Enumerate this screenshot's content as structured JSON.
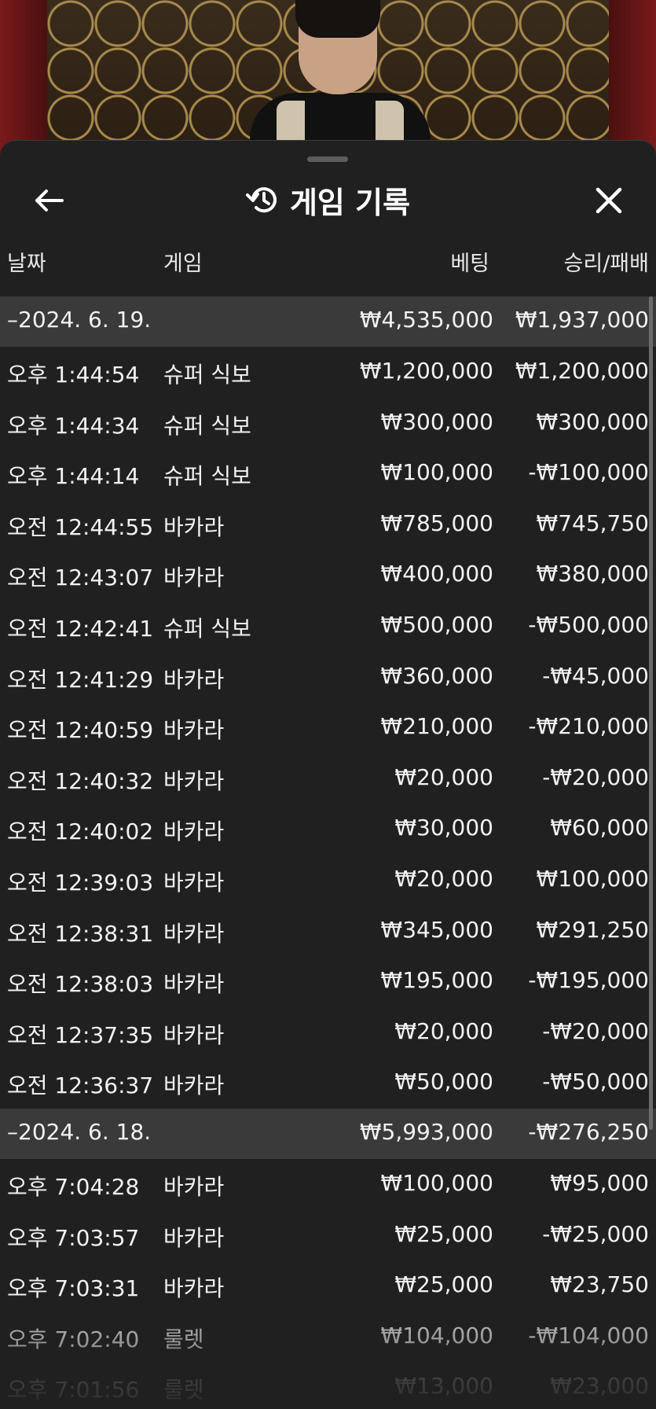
{
  "header": {
    "title": "게임 기록",
    "back_icon": "arrow-left-icon",
    "history_icon": "history-icon",
    "close_icon": "close-icon"
  },
  "columns": {
    "date": "날짜",
    "game": "게임",
    "bet": "베팅",
    "result": "승리/패배"
  },
  "groups": [
    {
      "date": "–2024. 6. 19.",
      "total_bet": "₩4,535,000",
      "total_result": "₩1,937,000",
      "rows": [
        {
          "time": "오후 1:44:54",
          "game": "슈퍼 식보",
          "bet": "₩1,200,000",
          "result": "₩1,200,000"
        },
        {
          "time": "오후 1:44:34",
          "game": "슈퍼 식보",
          "bet": "₩300,000",
          "result": "₩300,000"
        },
        {
          "time": "오후 1:44:14",
          "game": "슈퍼 식보",
          "bet": "₩100,000",
          "result": "-₩100,000"
        },
        {
          "time": "오전 12:44:55",
          "game": "바카라",
          "bet": "₩785,000",
          "result": "₩745,750"
        },
        {
          "time": "오전 12:43:07",
          "game": "바카라",
          "bet": "₩400,000",
          "result": "₩380,000"
        },
        {
          "time": "오전 12:42:41",
          "game": "슈퍼 식보",
          "bet": "₩500,000",
          "result": "-₩500,000"
        },
        {
          "time": "오전 12:41:29",
          "game": "바카라",
          "bet": "₩360,000",
          "result": "-₩45,000"
        },
        {
          "time": "오전 12:40:59",
          "game": "바카라",
          "bet": "₩210,000",
          "result": "-₩210,000"
        },
        {
          "time": "오전 12:40:32",
          "game": "바카라",
          "bet": "₩20,000",
          "result": "-₩20,000"
        },
        {
          "time": "오전 12:40:02",
          "game": "바카라",
          "bet": "₩30,000",
          "result": "₩60,000"
        },
        {
          "time": "오전 12:39:03",
          "game": "바카라",
          "bet": "₩20,000",
          "result": "₩100,000"
        },
        {
          "time": "오전 12:38:31",
          "game": "바카라",
          "bet": "₩345,000",
          "result": "₩291,250"
        },
        {
          "time": "오전 12:38:03",
          "game": "바카라",
          "bet": "₩195,000",
          "result": "-₩195,000"
        },
        {
          "time": "오전 12:37:35",
          "game": "바카라",
          "bet": "₩20,000",
          "result": "-₩20,000"
        },
        {
          "time": "오전 12:36:37",
          "game": "바카라",
          "bet": "₩50,000",
          "result": "-₩50,000"
        }
      ]
    },
    {
      "date": "–2024. 6. 18.",
      "total_bet": "₩5,993,000",
      "total_result": "-₩276,250",
      "rows": [
        {
          "time": "오후 7:04:28",
          "game": "바카라",
          "bet": "₩100,000",
          "result": "₩95,000"
        },
        {
          "time": "오후 7:03:57",
          "game": "바카라",
          "bet": "₩25,000",
          "result": "-₩25,000"
        },
        {
          "time": "오후 7:03:31",
          "game": "바카라",
          "bet": "₩25,000",
          "result": "₩23,750"
        },
        {
          "time": "오후 7:02:40",
          "game": "룰렛",
          "bet": "₩104,000",
          "result": "-₩104,000"
        },
        {
          "time": "오후 7:01:56",
          "game": "룰렛",
          "bet": "₩13,000",
          "result": "₩23,000"
        }
      ]
    }
  ]
}
